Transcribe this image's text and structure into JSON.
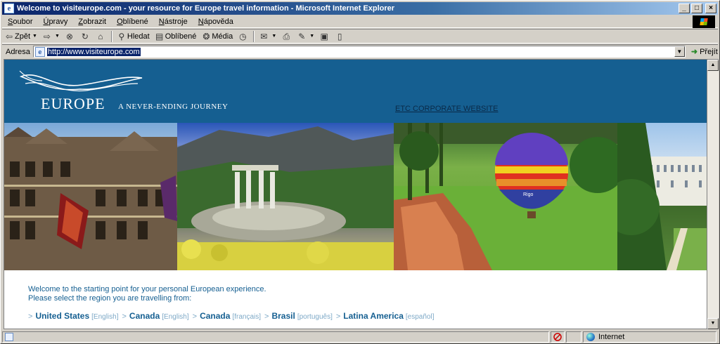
{
  "window": {
    "title": "Welcome to visiteurope.com - your resource for Europe travel information - Microsoft Internet Explorer",
    "buttons": {
      "minimize": "_",
      "maximize": "□",
      "close": "×"
    }
  },
  "menu": [
    "Soubor",
    "Úpravy",
    "Zobrazit",
    "Oblíbené",
    "Nástroje",
    "Nápověda"
  ],
  "toolbar": {
    "back_label": "Zpět",
    "search_label": "Hledat",
    "favorites_label": "Oblíbené",
    "media_label": "Média"
  },
  "addressbar": {
    "label": "Adresa",
    "url": "http://www.visiteurope.com",
    "go_label": "Přejít"
  },
  "page": {
    "logo_word": "EUROPE",
    "logo_tagline": "A NEVER-ENDING JOURNEY",
    "corporate_link": "ETC CORPORATE WEBSITE",
    "intro_line1": "Welcome to the starting point for your personal European experience.",
    "intro_line2": "Please select the region you are travelling from:",
    "regions": [
      {
        "name": "United States",
        "lang": "[English]"
      },
      {
        "name": "Canada",
        "lang": "[English]"
      },
      {
        "name": "Canada",
        "lang": "[français]"
      },
      {
        "name": "Brasil",
        "lang": "[português]"
      },
      {
        "name": "Latina America",
        "lang": "[español]"
      }
    ],
    "region_separator": ">",
    "balloon_text": "Rigo"
  },
  "statusbar": {
    "zone": "Internet"
  },
  "colors": {
    "banner": "#155f91",
    "text_primary": "#155f91",
    "text_muted": "#7ea9c7",
    "titlebar_start": "#0a246a",
    "titlebar_end": "#a6caf0"
  }
}
